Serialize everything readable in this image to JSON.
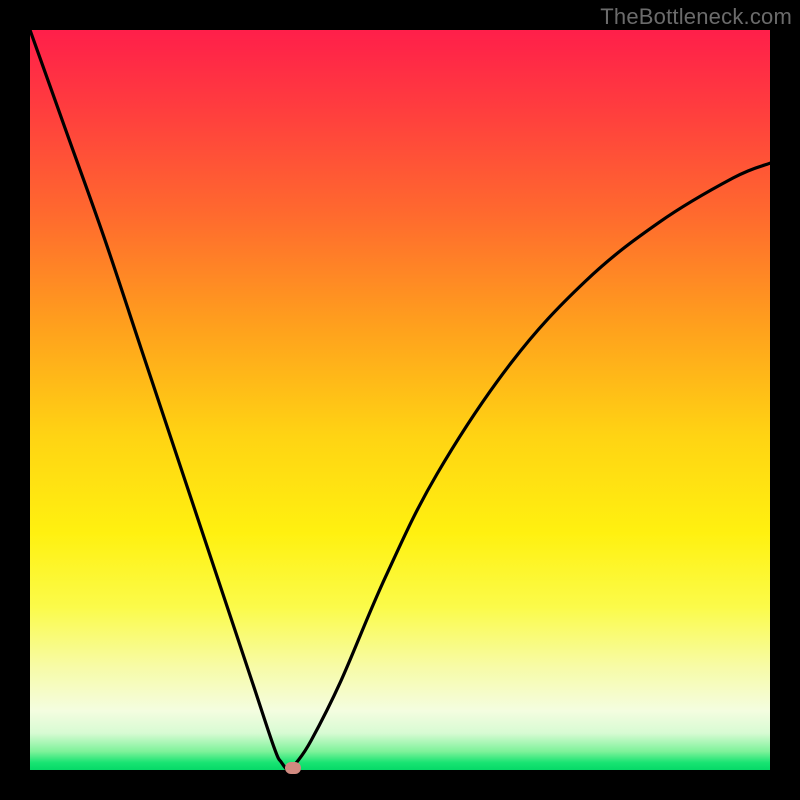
{
  "watermark": "TheBottleneck.com",
  "colors": {
    "frame": "#000000",
    "gradient_top": "#ff1f4a",
    "gradient_bottom": "#06d968",
    "curve": "#000000",
    "marker": "#d18a80"
  },
  "chart_data": {
    "type": "line",
    "title": "",
    "xlabel": "",
    "ylabel": "",
    "xlim": [
      0,
      100
    ],
    "ylim": [
      0,
      100
    ],
    "grid": false,
    "legend": false,
    "series": [
      {
        "name": "bottleneck-curve",
        "x": [
          0,
          5,
          10,
          15,
          20,
          25,
          30,
          33,
          34,
          35,
          36,
          38,
          42,
          48,
          55,
          65,
          75,
          85,
          95,
          100
        ],
        "values": [
          100,
          86,
          72,
          57,
          42,
          27,
          12,
          3,
          1,
          0,
          1,
          4,
          12,
          26,
          40,
          55,
          66,
          74,
          80,
          82
        ]
      }
    ],
    "annotations": [
      {
        "name": "optimum-marker",
        "x": 35.5,
        "y": 0
      }
    ]
  }
}
